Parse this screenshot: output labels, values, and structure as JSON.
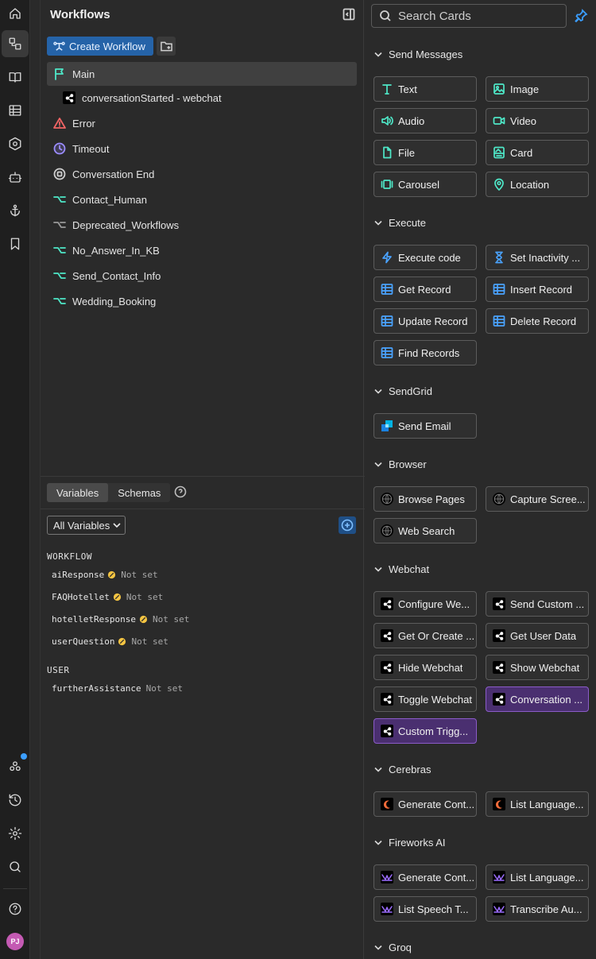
{
  "workflows_panel": {
    "title": "Workflows",
    "create_label": "Create Workflow",
    "items": [
      {
        "label": "Main",
        "icon": "flag-icon",
        "color": "#4ee8c8"
      },
      {
        "label": "conversationStarted - webchat",
        "icon": "share-icon"
      },
      {
        "label": "Error",
        "icon": "warning-icon",
        "color": "#f06464"
      },
      {
        "label": "Timeout",
        "icon": "clock-icon",
        "color": "#9b8cff"
      },
      {
        "label": "Conversation End",
        "icon": "stop-circle-icon",
        "color": "#cfcfcf"
      },
      {
        "label": "Contact_Human",
        "icon": "branch-icon",
        "color": "#4ee8c8"
      },
      {
        "label": "Deprecated_Workflows",
        "icon": "branch-icon",
        "color": "#9a9a9a"
      },
      {
        "label": "No_Answer_In_KB",
        "icon": "branch-icon",
        "color": "#4ee8c8"
      },
      {
        "label": "Send_Contact_Info",
        "icon": "branch-icon",
        "color": "#4ee8c8"
      },
      {
        "label": "Wedding_Booking",
        "icon": "branch-icon",
        "color": "#4ee8c8"
      }
    ]
  },
  "variables": {
    "tabs": [
      "Variables",
      "Schemas"
    ],
    "filter": "All Variables",
    "groups": [
      {
        "name": "WORKFLOW",
        "vars": [
          {
            "name": "aiResponse",
            "value": "Not set",
            "warn": true
          },
          {
            "name": "FAQHotellet",
            "value": "Not set",
            "warn": true
          },
          {
            "name": "hotelletResponse",
            "value": "Not set",
            "warn": true
          },
          {
            "name": "userQuestion",
            "value": "Not set",
            "warn": true
          }
        ]
      },
      {
        "name": "USER",
        "vars": [
          {
            "name": "furtherAssistance",
            "value": "Not set",
            "warn": false
          }
        ]
      }
    ]
  },
  "cards_panel": {
    "search_placeholder": "Search Cards",
    "sections": [
      {
        "title": "Send Messages",
        "cards": [
          {
            "label": "Text",
            "icon": "text-icon"
          },
          {
            "label": "Image",
            "icon": "image-icon"
          },
          {
            "label": "Audio",
            "icon": "speaker-icon"
          },
          {
            "label": "Video",
            "icon": "video-icon"
          },
          {
            "label": "File",
            "icon": "file-icon"
          },
          {
            "label": "Card",
            "icon": "card-icon"
          },
          {
            "label": "Carousel",
            "icon": "carousel-icon"
          },
          {
            "label": "Location",
            "icon": "location-icon"
          }
        ]
      },
      {
        "title": "Execute",
        "cards": [
          {
            "label": "Execute code",
            "icon": "lightning-icon"
          },
          {
            "label": "Set Inactivity ...",
            "icon": "hourglass-icon"
          },
          {
            "label": "Get Record",
            "icon": "table-icon"
          },
          {
            "label": "Insert Record",
            "icon": "table-icon"
          },
          {
            "label": "Update Record",
            "icon": "table-icon"
          },
          {
            "label": "Delete Record",
            "icon": "table-icon"
          },
          {
            "label": "Find Records",
            "icon": "table-icon"
          }
        ]
      },
      {
        "title": "SendGrid",
        "cards": [
          {
            "label": "Send Email",
            "icon": "sendgrid-icon"
          }
        ]
      },
      {
        "title": "Browser",
        "cards": [
          {
            "label": "Browse Pages",
            "icon": "globe-icon"
          },
          {
            "label": "Capture Scree...",
            "icon": "globe-icon"
          },
          {
            "label": "Web Search",
            "icon": "globe-icon"
          }
        ]
      },
      {
        "title": "Webchat",
        "cards": [
          {
            "label": "Configure We...",
            "icon": "share-icon"
          },
          {
            "label": "Send Custom ...",
            "icon": "share-icon"
          },
          {
            "label": "Get Or Create ...",
            "icon": "share-icon"
          },
          {
            "label": "Get User Data",
            "icon": "share-icon"
          },
          {
            "label": "Hide Webchat",
            "icon": "share-icon"
          },
          {
            "label": "Show Webchat",
            "icon": "share-icon"
          },
          {
            "label": "Toggle Webchat",
            "icon": "share-icon"
          },
          {
            "label": "Conversation ...",
            "icon": "share-icon",
            "highlight": true
          },
          {
            "label": "Custom Trigg...",
            "icon": "share-icon",
            "highlight": true
          }
        ]
      },
      {
        "title": "Cerebras",
        "cards": [
          {
            "label": "Generate Cont...",
            "icon": "cerebras-icon"
          },
          {
            "label": "List Language...",
            "icon": "cerebras-icon"
          }
        ]
      },
      {
        "title": "Fireworks AI",
        "cards": [
          {
            "label": "Generate Cont...",
            "icon": "fireworks-icon"
          },
          {
            "label": "List Language...",
            "icon": "fireworks-icon"
          },
          {
            "label": "List Speech T...",
            "icon": "fireworks-icon"
          },
          {
            "label": "Transcribe Au...",
            "icon": "fireworks-icon"
          }
        ]
      },
      {
        "title": "Groq",
        "cards": []
      }
    ]
  },
  "user": {
    "initials": "PJ"
  },
  "colors": {
    "accent": "#2563a8",
    "teal": "#4ee8c8",
    "highlight": "#4a2f70",
    "pin": "#3b9eff"
  }
}
